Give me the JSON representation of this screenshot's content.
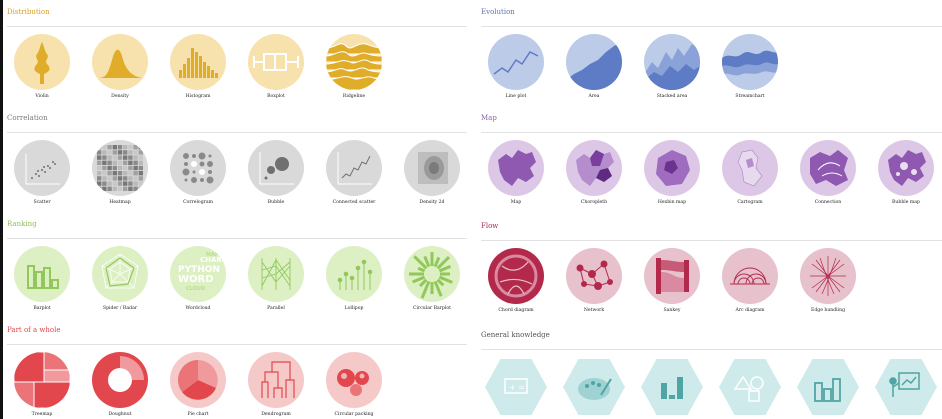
{
  "sections": {
    "distribution": {
      "title": "Distribution",
      "color": "#d79f1e",
      "items": [
        "Violin",
        "Density",
        "Histogram",
        "Boxplot",
        "Ridgeline"
      ]
    },
    "evolution": {
      "title": "Evolution",
      "color": "#5c74b4",
      "items": [
        "Line plot",
        "Area",
        "Stacked area",
        "Streamchart"
      ]
    },
    "correlation": {
      "title": "Correlation",
      "color": "#7a7a7a",
      "items": [
        "Scatter",
        "Heatmap",
        "Correlogram",
        "Bubble",
        "Connected scatter",
        "Density 2d"
      ]
    },
    "map": {
      "title": "Map",
      "color": "#8d62a8",
      "items": [
        "Map",
        "Choropleth",
        "Hexbin map",
        "Cartogram",
        "Connection",
        "Bubble map"
      ]
    },
    "ranking": {
      "title": "Ranking",
      "color": "#8fbf5a",
      "items": [
        "Barplot",
        "Spider / Radar",
        "Wordcloud",
        "Parallel",
        "Lollipop",
        "Circular Barplot"
      ]
    },
    "flow": {
      "title": "Flow",
      "color": "#b0294d",
      "items": [
        "Chord diagram",
        "Network",
        "Sankey",
        "Arc diagram",
        "Edge bundling"
      ]
    },
    "part_of_whole": {
      "title": "Part of a whole",
      "color": "#e0474c",
      "items": [
        "Treemap",
        "Doughnut",
        "Pie chart",
        "Dendrogram",
        "Circular packing"
      ]
    },
    "general_knowledge": {
      "title": "General knowledge",
      "color": "#555555",
      "items": []
    }
  },
  "wordcloud_words": [
    "PYTHON",
    "WORD",
    "CHAR",
    "MAP",
    "CLOUD"
  ],
  "palette": {
    "distribution_bg": "#f7e2ae",
    "distribution_fg": "#e0ad2b",
    "evolution_bg": "#bccbe8",
    "evolution_fg": "#5e7cc6",
    "correlation_bg": "#d9d9d9",
    "correlation_fg": "#707070",
    "map_bg": "#dcc8e6",
    "map_fg": "#8f58b1",
    "ranking_bg": "#dcf0c3",
    "ranking_fg": "#92c85a",
    "flow_bg": "#e7c1cb",
    "flow_fg": "#b2294c",
    "whole_bg": "#f6c9c9",
    "whole_fg": "#e2474d",
    "general_bg": "#cfeaea",
    "general_fg": "#4fa5a5"
  }
}
